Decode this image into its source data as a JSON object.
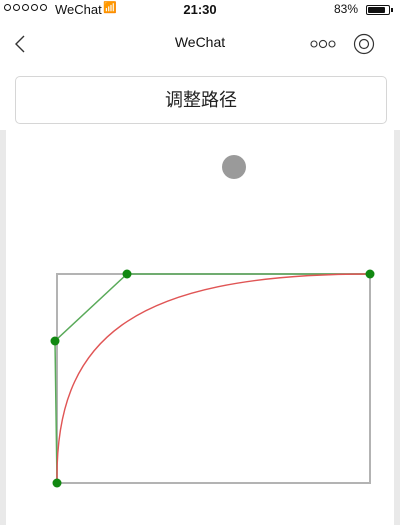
{
  "status_bar": {
    "carrier": "WeChat",
    "time": "21:30",
    "battery_percent": "83%",
    "battery_level": 0.83,
    "signal_dots": 5
  },
  "nav": {
    "title": "WeChat",
    "back_icon": "chevron-left-icon",
    "more_icon": "more-dots-icon",
    "close_icon": "target-circle-icon"
  },
  "main": {
    "adjust_button_label": "调整路径"
  },
  "colors": {
    "frame": "#b3b3b3",
    "control_polygon": "#5aaa5a",
    "bezier_curve": "#e05555",
    "control_point": "#118811",
    "ball": "#9a9a9a"
  }
}
